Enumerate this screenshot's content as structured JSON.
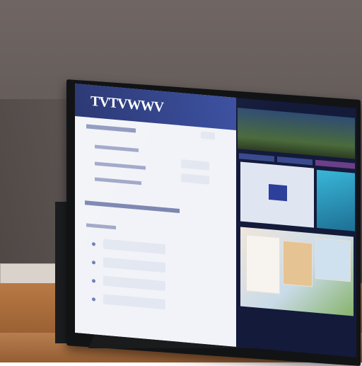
{
  "scene": {
    "tv_screen": {
      "logo_text": "TVTVWWV",
      "form_section_title": "",
      "list_section_title": "",
      "accent_color": "#2c3f9a",
      "header_color": "#1c2a6b"
    },
    "colors": {
      "wall": "#6f6663",
      "cabinet": "#9c6233",
      "bezel": "#121315"
    }
  }
}
